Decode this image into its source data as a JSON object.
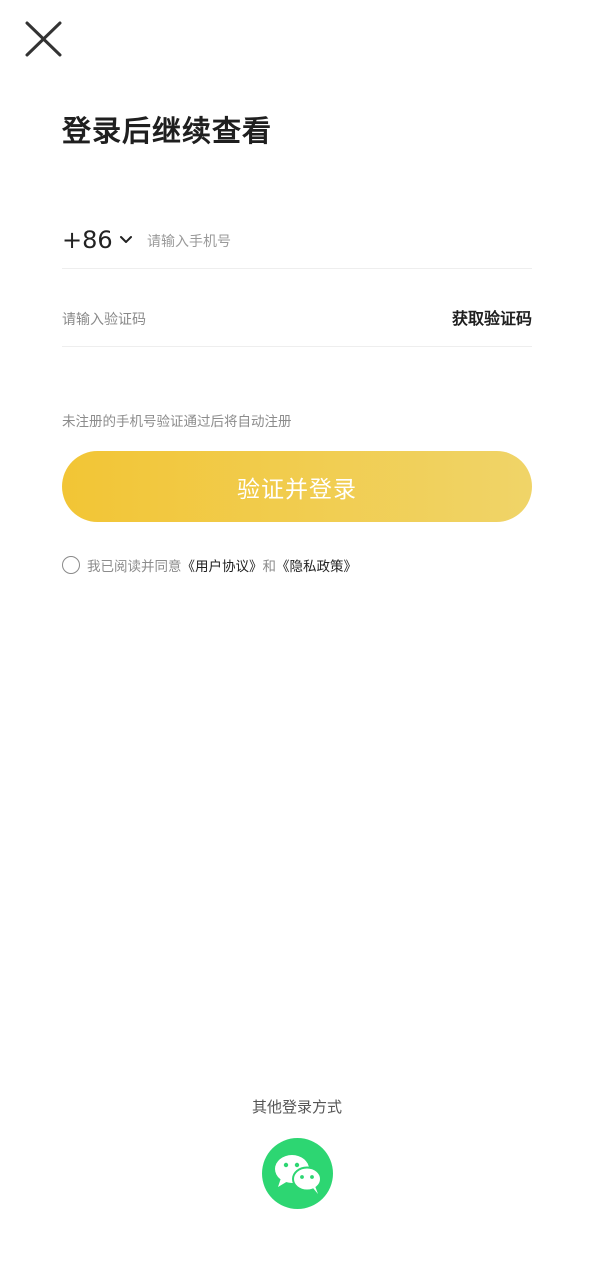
{
  "header": {
    "close_icon": "close-icon",
    "title": "登录后继续查看"
  },
  "phone": {
    "country_code": "+86",
    "chevron_icon": "chevron-down-icon",
    "placeholder": "请输入手机号",
    "value": ""
  },
  "code": {
    "placeholder": "请输入验证码",
    "value": "",
    "get_code_label": "获取验证码"
  },
  "hint": "未注册的手机号验证通过后将自动注册",
  "submit": {
    "label": "验证并登录"
  },
  "agreement": {
    "checked": false,
    "prefix": "我已阅读并同意",
    "user_agreement": "《用户协议》",
    "and": "和",
    "privacy_policy": "《隐私政策》"
  },
  "other_login": {
    "label": "其他登录方式",
    "wechat_icon": "wechat-icon"
  },
  "colors": {
    "accent_start": "#f2c535",
    "accent_end": "#f0d468",
    "wechat": "#2dd672"
  }
}
